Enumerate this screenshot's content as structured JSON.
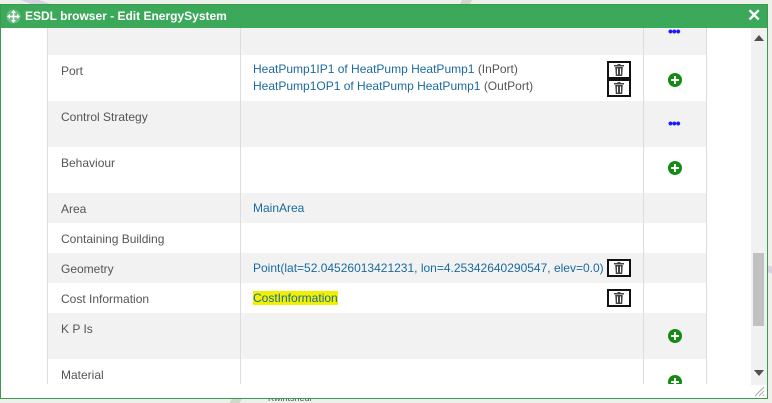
{
  "window": {
    "title": "ESDL browser - Edit EnergySystem"
  },
  "map": {
    "label": "Kwintsheul"
  },
  "rows": [
    {
      "name": "",
      "action": "dots"
    },
    {
      "name": "Port",
      "ports": [
        {
          "link": "HeatPump1IP1 of HeatPump HeatPump1",
          "type": "(InPort)"
        },
        {
          "link": "HeatPump1OP1 of HeatPump HeatPump1",
          "type": "(OutPort)"
        }
      ],
      "action": "add"
    },
    {
      "name": "Control Strategy",
      "action": "dots"
    },
    {
      "name": "Behaviour",
      "action": "add"
    },
    {
      "name": "Area",
      "value": "MainArea"
    },
    {
      "name": "Containing Building"
    },
    {
      "name": "Geometry",
      "value": "Point(lat=52.04526013421231, lon=4.25342640290547, elev=0.0)"
    },
    {
      "name": "Cost Information",
      "value": "CostInformation"
    },
    {
      "name": "K P Is",
      "action": "add"
    },
    {
      "name": "Material",
      "action": "add"
    }
  ],
  "colors": {
    "titlebar": "#3ca85a",
    "link": "#1a6aa0",
    "add": "#148c14",
    "highlight": "#f0f000"
  },
  "icons": {
    "move": "move-icon",
    "close": "close-icon",
    "delete": "trash-icon",
    "add": "plus-icon",
    "more": "ellipsis-icon"
  }
}
